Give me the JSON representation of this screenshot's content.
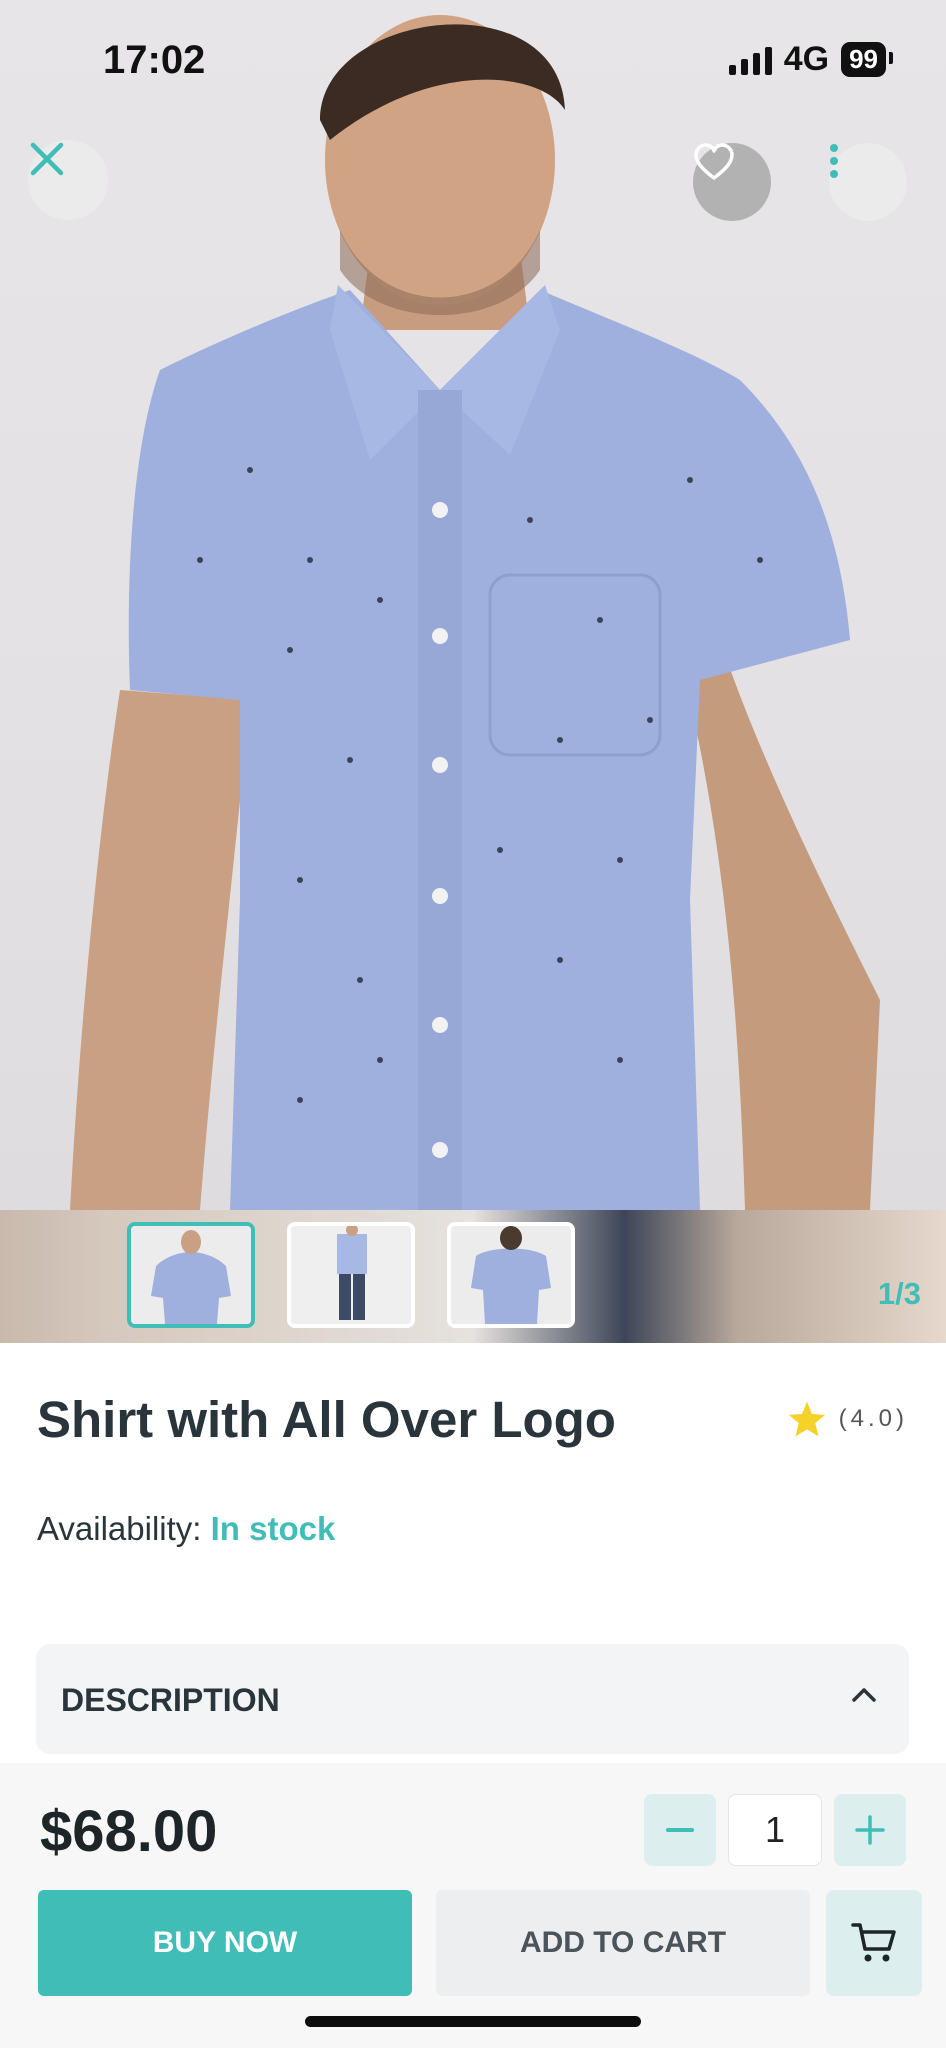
{
  "status_bar": {
    "time": "17:02",
    "network": "4G",
    "battery": "99"
  },
  "gallery": {
    "counter": "1/3",
    "thumbnail_count": 3,
    "selected_index": 1
  },
  "product": {
    "title": "Shirt with All Over Logo",
    "rating": "(4.0)",
    "availability_label": "Availability: ",
    "availability_value": "In stock"
  },
  "description": {
    "label": "DESCRIPTION"
  },
  "purchase": {
    "price": "$68.00",
    "quantity": "1",
    "buy_label": "BUY NOW",
    "cart_label": "ADD TO CART"
  },
  "colors": {
    "accent": "#3fbdb6",
    "star": "#f5d22a",
    "shirt": "#9fb0de"
  },
  "icons": [
    "close-icon",
    "heart-icon",
    "more-vertical-icon",
    "star-icon",
    "chevron-up-icon",
    "minus-icon",
    "plus-icon",
    "cart-icon"
  ]
}
